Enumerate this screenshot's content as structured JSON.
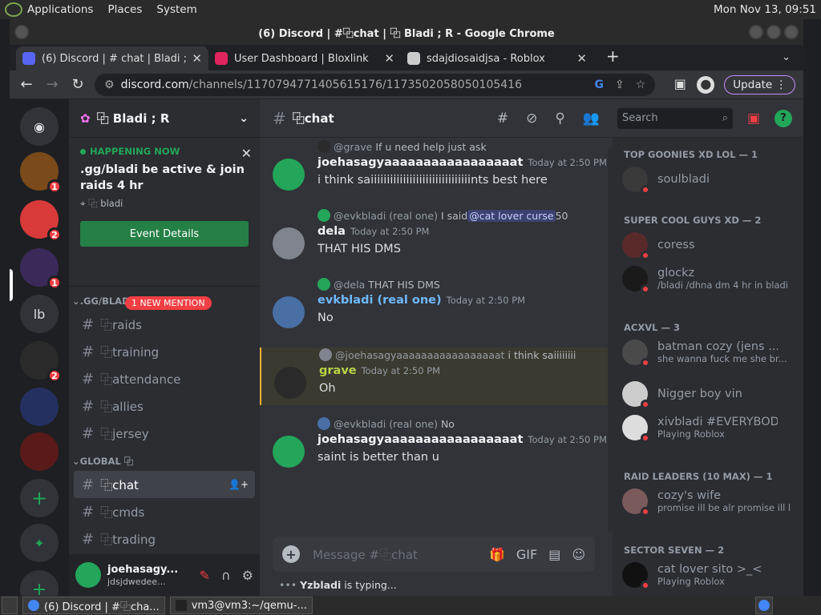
{
  "topbar": {
    "menus": [
      "Applications",
      "Places",
      "System"
    ],
    "clock": "Mon Nov 13, 09:51"
  },
  "window": {
    "title": "(6) Discord | #⿻chat | ⿻ Bladi ; R - Google Chrome"
  },
  "tabs": [
    {
      "label": "(6) Discord | # chat | Bladi ; R",
      "badge": "6"
    },
    {
      "label": "User Dashboard | Bloxlink"
    },
    {
      "label": "sdajdiosaidjsa - Roblox"
    }
  ],
  "address": {
    "host": "discord.com",
    "path": "/channels/1170794771405615176/1173502058050105416",
    "update": "Update"
  },
  "servers": [
    {
      "label": "",
      "badge": "1",
      "color": "#7a4a1a"
    },
    {
      "label": "",
      "badge": "2",
      "color": "#d83a3a"
    },
    {
      "label": "",
      "badge": "1",
      "color": "#3a2a5a"
    },
    {
      "label": "lb",
      "badge": ""
    },
    {
      "label": "",
      "badge": "2",
      "color": "#2a2a2a"
    },
    {
      "label": "",
      "badge": "",
      "color": "#243060"
    },
    {
      "label": "",
      "badge": "",
      "color": "#5a1a1a"
    }
  ],
  "guild": {
    "name": "⿻ Bladi ; R"
  },
  "event": {
    "status": "HAPPENING NOW",
    "title": ".gg/bladi be active & join raids 4 hr",
    "location": "⿻ bladi",
    "button": "Event Details"
  },
  "categories": {
    "first": ".GG/BLADI",
    "mention": "1 NEW MENTION",
    "second": "GLOBAL ⿻"
  },
  "channels": [
    "⿻raids",
    "⿻training",
    "⿻attendance",
    "⿻allies",
    "⿻jersey"
  ],
  "global_channels": [
    "⿻chat",
    "⿻cmds",
    "⿻trading"
  ],
  "user": {
    "name": "joehasagy...",
    "tag": "jdsjdwedee..."
  },
  "chat": {
    "channel": "⿻chat",
    "placeholder": "Message #⿻chat",
    "typing_user": "Yzbladi",
    "typing_suffix": " is typing..."
  },
  "messages": [
    {
      "reply_name": "@grave",
      "reply_text": "If u need help just ask",
      "author": "joehasagyaaaaaaaaaaaaaaaaat",
      "time": "Today at 2:50 PM",
      "text": "i think saiiiiiiiiiiiiiiiiiiiiiiiiiiiiiiints best here",
      "author_color": "#f2f3f5"
    },
    {
      "reply_name": "@evkbladi (real one)",
      "reply_text": "I said ",
      "reply_mention": "@cat lover curse",
      "reply_tail": " 50",
      "author": "dela",
      "time": "Today at 2:50 PM",
      "text": "THAT HIS DMS",
      "author_color": "#f2f3f5"
    },
    {
      "reply_name": "@dela",
      "reply_text": "THAT HIS DMS",
      "author": "evkbladi (real one)",
      "time": "Today at 2:50 PM",
      "text": "No",
      "author_color": "#6fb8ff"
    },
    {
      "reply_name": "@joehasagyaaaaaaaaaaaaaaaaat",
      "reply_text": "i think saiiiiiiii",
      "author": "grave",
      "time": "Today at 2:50 PM",
      "text": "Oh",
      "author_color": "#b8d34a"
    },
    {
      "reply_name": "@evkbladi (real one)",
      "reply_text": "No",
      "author": "joehasagyaaaaaaaaaaaaaaaaat",
      "time": "Today at 2:50 PM",
      "text": "saint is  better than u",
      "author_color": "#f2f3f5"
    }
  ],
  "search": {
    "placeholder": "Search"
  },
  "member_groups": [
    {
      "title": "TOP GOONIES XD LOL — 1",
      "members": [
        {
          "name": "soulbladi",
          "sub": ""
        }
      ]
    },
    {
      "title": "SUPER COOL GUYS XD — 2",
      "members": [
        {
          "name": "coress",
          "sub": ""
        },
        {
          "name": "glockz",
          "sub": "/bladi /dhna dm 4 hr in bladi"
        }
      ]
    },
    {
      "title": "ACXVL — 3",
      "members": [
        {
          "name": "batman cozy (jens ...",
          "sub": "she wanna fuck me she br..."
        },
        {
          "name": "Nigger boy vin",
          "sub": ""
        },
        {
          "name": "xivbladi #EVERYBOD...",
          "sub": "Playing Roblox"
        }
      ]
    },
    {
      "title": "RAID LEADERS (10 MAX) — 1",
      "members": [
        {
          "name": "cozy's wife",
          "sub": "promise ill be alr promise ill b..."
        }
      ]
    },
    {
      "title": "SECTOR SEVEN — 2",
      "members": [
        {
          "name": "cat lover sito >_<",
          "sub": "Playing Roblox"
        }
      ]
    }
  ],
  "taskbar": {
    "items": [
      "(6) Discord | #⿻cha...",
      "vm3@vm3:~/qemu-..."
    ]
  },
  "colors": {
    "accent": "#5865f2",
    "online": "#23a55a",
    "dnd": "#f23f43",
    "nitro": "#ff73fa"
  }
}
